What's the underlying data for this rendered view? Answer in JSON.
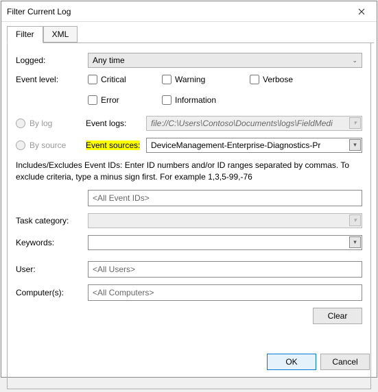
{
  "window": {
    "title": "Filter Current Log"
  },
  "tabs": {
    "filter": "Filter",
    "xml": "XML"
  },
  "labels": {
    "logged": "Logged:",
    "eventLevel": "Event level:",
    "byLog": "By log",
    "bySource": "By source",
    "eventLogs": "Event logs:",
    "eventSources": "Event sources:",
    "taskCategory": "Task category:",
    "keywords": "Keywords:",
    "user": "User:",
    "computers": "Computer(s):"
  },
  "values": {
    "logged": "Any time",
    "eventLogs": "file://C:\\Users\\Contoso\\Documents\\logs\\FieldMedi",
    "eventSources": "DeviceManagement-Enterprise-Diagnostics-Pr",
    "eventIds": "<All Event IDs>",
    "user": "<All Users>",
    "computers": "<All Computers>"
  },
  "checkboxes": {
    "critical": "Critical",
    "warning": "Warning",
    "verbose": "Verbose",
    "error": "Error",
    "information": "Information"
  },
  "help": "Includes/Excludes Event IDs: Enter ID numbers and/or ID ranges separated by commas. To exclude criteria, type a minus sign first. For example 1,3,5-99,-76",
  "buttons": {
    "clear": "Clear",
    "ok": "OK",
    "cancel": "Cancel"
  }
}
